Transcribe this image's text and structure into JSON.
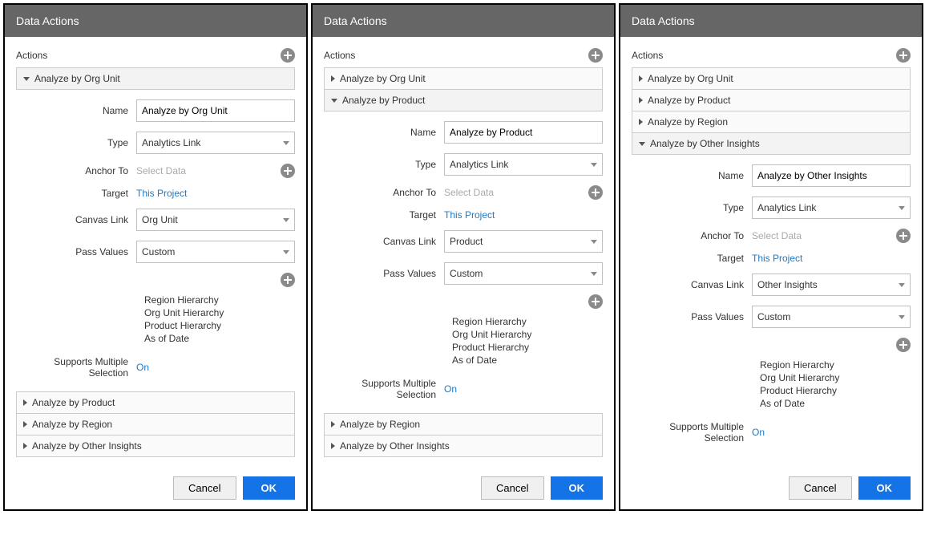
{
  "dialogs": [
    {
      "title": "Data Actions",
      "sectionLabel": "Actions",
      "accordionTop": [
        {
          "label": "Analyze by Org Unit",
          "expanded": true
        }
      ],
      "form": {
        "nameLabel": "Name",
        "nameValue": "Analyze by Org Unit",
        "typeLabel": "Type",
        "typeValue": "Analytics Link",
        "anchorLabel": "Anchor To",
        "anchorPlaceholder": "Select Data",
        "targetLabel": "Target",
        "targetValue": "This Project",
        "canvasLabel": "Canvas Link",
        "canvasValue": "Org Unit",
        "passLabel": "Pass Values",
        "passValue": "Custom",
        "hierarchies": [
          "Region Hierarchy",
          "Org Unit Hierarchy",
          "Product Hierarchy",
          "As of Date"
        ],
        "supportsLabel": "Supports Multiple Selection",
        "supportsValue": "On"
      },
      "accordionBottom": [
        {
          "label": "Analyze by Product"
        },
        {
          "label": "Analyze by Region"
        },
        {
          "label": "Analyze by Other Insights"
        }
      ],
      "cancel": "Cancel",
      "ok": "OK"
    },
    {
      "title": "Data Actions",
      "sectionLabel": "Actions",
      "accordionTop": [
        {
          "label": "Analyze by Org Unit",
          "expanded": false
        },
        {
          "label": "Analyze by Product",
          "expanded": true
        }
      ],
      "form": {
        "nameLabel": "Name",
        "nameValue": "Analyze by Product",
        "typeLabel": "Type",
        "typeValue": "Analytics Link",
        "anchorLabel": "Anchor To",
        "anchorPlaceholder": "Select Data",
        "targetLabel": "Target",
        "targetValue": "This Project",
        "canvasLabel": "Canvas Link",
        "canvasValue": "Product",
        "passLabel": "Pass Values",
        "passValue": "Custom",
        "hierarchies": [
          "Region Hierarchy",
          "Org Unit Hierarchy",
          "Product Hierarchy",
          "As of Date"
        ],
        "supportsLabel": "Supports Multiple Selection",
        "supportsValue": "On"
      },
      "accordionBottom": [
        {
          "label": "Analyze by Region"
        },
        {
          "label": "Analyze by Other Insights"
        }
      ],
      "cancel": "Cancel",
      "ok": "OK"
    },
    {
      "title": "Data Actions",
      "sectionLabel": "Actions",
      "accordionTop": [
        {
          "label": "Analyze by Org Unit",
          "expanded": false
        },
        {
          "label": "Analyze by Product",
          "expanded": false
        },
        {
          "label": "Analyze by Region",
          "expanded": false
        },
        {
          "label": "Analyze by Other Insights",
          "expanded": true
        }
      ],
      "form": {
        "nameLabel": "Name",
        "nameValue": "Analyze by Other Insights",
        "typeLabel": "Type",
        "typeValue": "Analytics Link",
        "anchorLabel": "Anchor To",
        "anchorPlaceholder": "Select Data",
        "targetLabel": "Target",
        "targetValue": "This Project",
        "canvasLabel": "Canvas Link",
        "canvasValue": "Other Insights",
        "passLabel": "Pass Values",
        "passValue": "Custom",
        "hierarchies": [
          "Region Hierarchy",
          "Org Unit Hierarchy",
          "Product Hierarchy",
          "As of Date"
        ],
        "supportsLabel": "Supports Multiple Selection",
        "supportsValue": "On"
      },
      "accordionBottom": [],
      "cancel": "Cancel",
      "ok": "OK"
    }
  ]
}
